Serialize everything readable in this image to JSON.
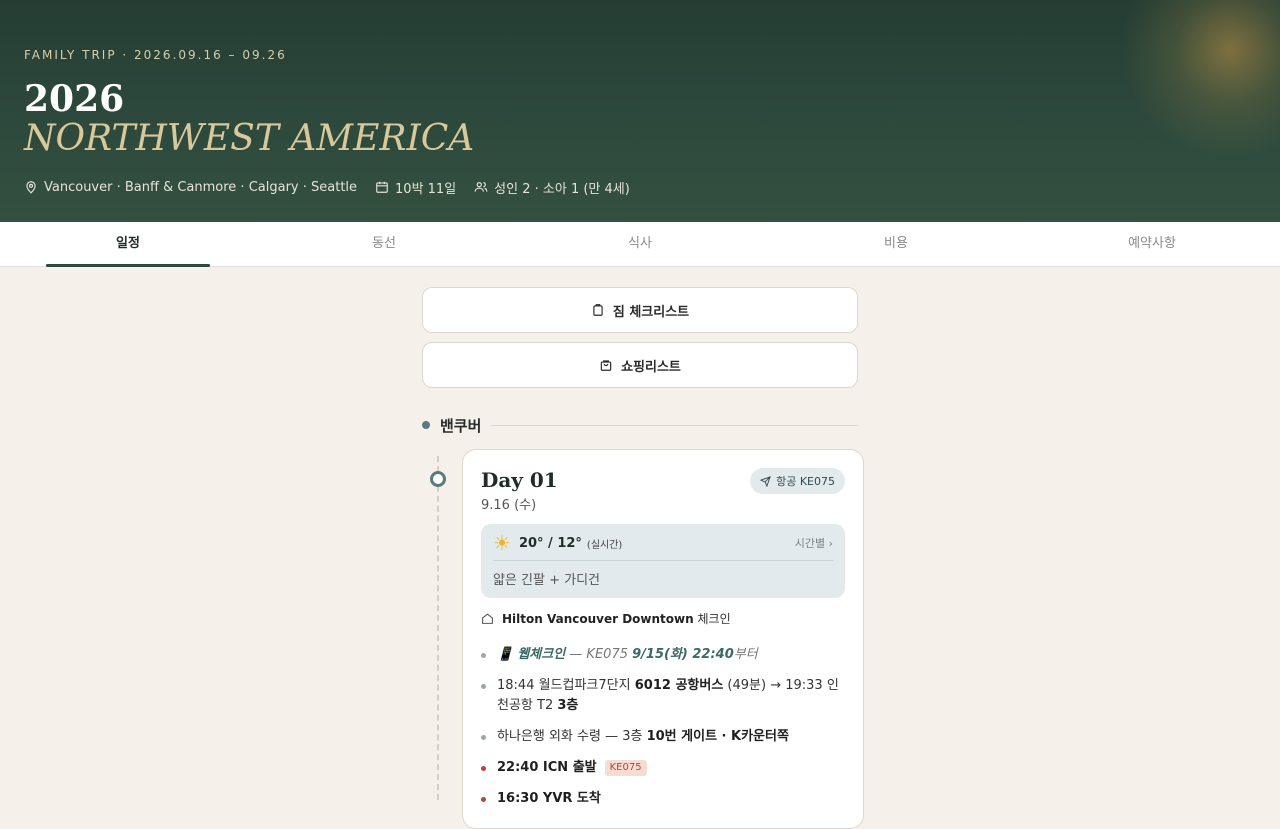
{
  "hero": {
    "eyebrow": "FAMILY TRIP · 2026.09.16 – 09.26",
    "year": "2026",
    "title": "NORTHWEST AMERICA",
    "locations": "Vancouver · Banff & Canmore · Calgary · Seattle",
    "duration": "10박 11일",
    "travelers": "성인 2 · 소아 1 (만 4세)"
  },
  "tabs": [
    {
      "label": "일정",
      "active": true
    },
    {
      "label": "동선",
      "active": false
    },
    {
      "label": "식사",
      "active": false
    },
    {
      "label": "비용",
      "active": false
    },
    {
      "label": "예약사항",
      "active": false
    }
  ],
  "buttons": {
    "packing": "짐 체크리스트",
    "shopping": "쇼핑리스트"
  },
  "city": {
    "name": "밴쿠버"
  },
  "day": {
    "title": "Day 01",
    "date": "9.16 (수)",
    "flight_badge": "항공 KE075",
    "weather": {
      "temp": "20° / 12°",
      "realtime": "(실시간)",
      "hourly": "시간별 ›",
      "note": "얇은 긴팔 + 가디건"
    },
    "hotel": {
      "name": "Hilton Vancouver Downtown",
      "action": "체크인"
    },
    "items": [
      {
        "a": "📱 ",
        "b": "웹체크인",
        "c": " — KE075 ",
        "d": "9/15(화) 22:40",
        "e": "부터"
      },
      {
        "a": "18:44 월드컵파크7단지 ",
        "b": "6012 공항버스",
        "c": " (49분) → 19:33 인천공항 T2 ",
        "d": "3층"
      },
      {
        "a": "하나은행 외화 수령 — 3층 ",
        "b": "10번 게이트 · K카운터쪽"
      },
      {
        "a": "22:40 ICN 출발",
        "badge": "KE075"
      },
      {
        "a": "16:30 YVR 도착"
      }
    ]
  },
  "colors": {
    "hero_bg": "#2e4a3d",
    "accent_gold": "#d8c89a",
    "page_bg": "#f5f1ea",
    "flight_red": "#b8442f"
  }
}
